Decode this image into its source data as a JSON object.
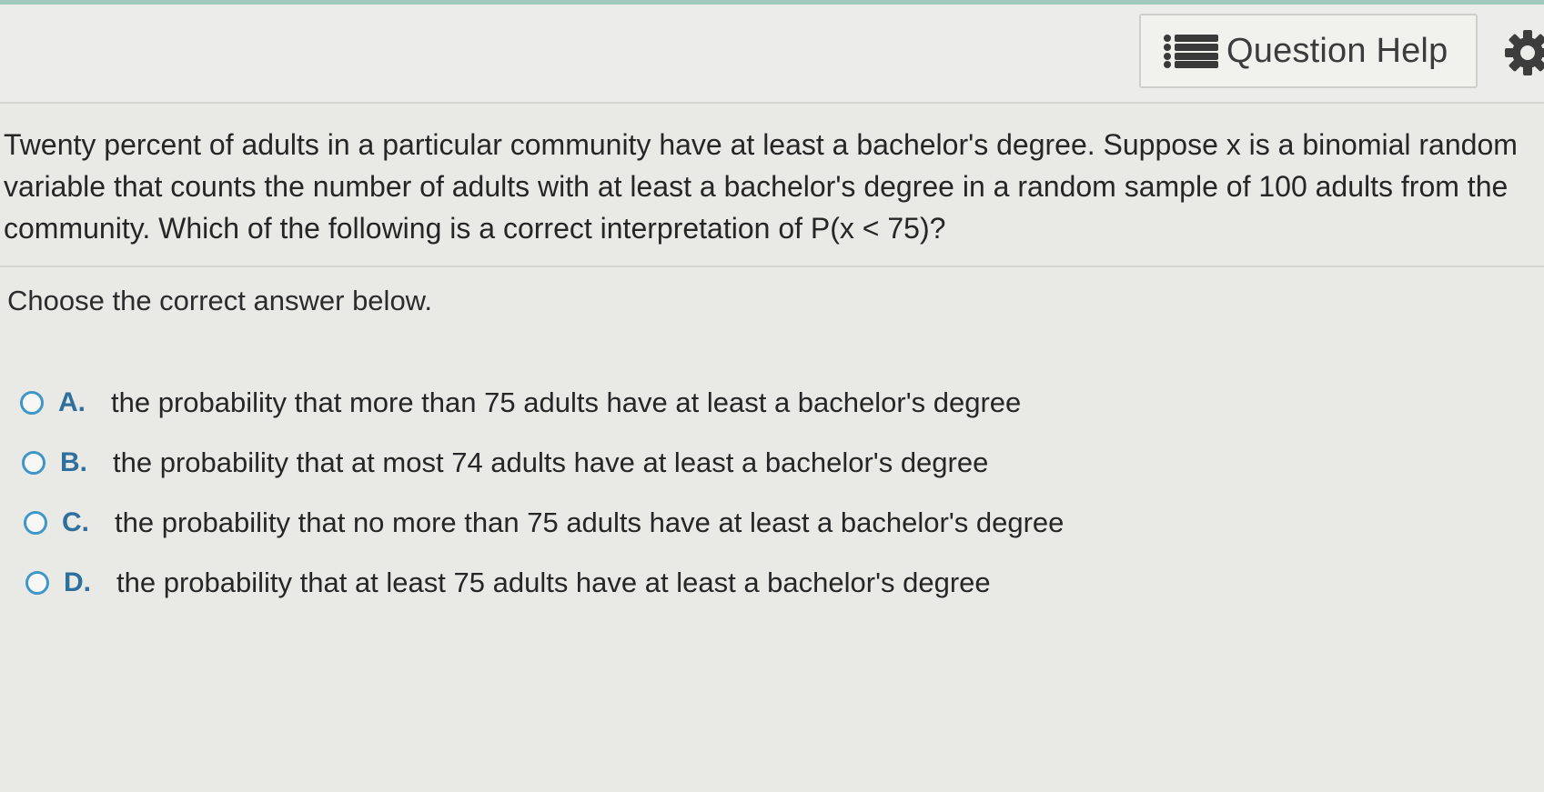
{
  "header": {
    "help_button_label": "Question Help",
    "help_icon": "list-icon",
    "settings_icon": "gear-icon"
  },
  "question": {
    "text": "Twenty percent of adults in a particular community have at least a bachelor's degree. Suppose x is a binomial random variable that counts the number of adults with at least a bachelor's degree in a random sample of 100 adults from the community. Which of the following is a correct interpretation of P(x < 75)?",
    "prompt": "Choose the correct answer below."
  },
  "choices": [
    {
      "letter": "A.",
      "text": "the probability that more than 75 adults have at least a bachelor's degree",
      "selected": false
    },
    {
      "letter": "B.",
      "text": "the probability that at most 74 adults have at least a bachelor's degree",
      "selected": false
    },
    {
      "letter": "C.",
      "text": "the probability that no more than 75 adults have at least a bachelor's degree",
      "selected": false
    },
    {
      "letter": "D.",
      "text": "the probability that at least 75 adults have at least a bachelor's degree",
      "selected": false
    }
  ],
  "colors": {
    "accent": "#3f97c9",
    "letter": "#2f6f9e",
    "top_strip": "#9fc9bd"
  }
}
